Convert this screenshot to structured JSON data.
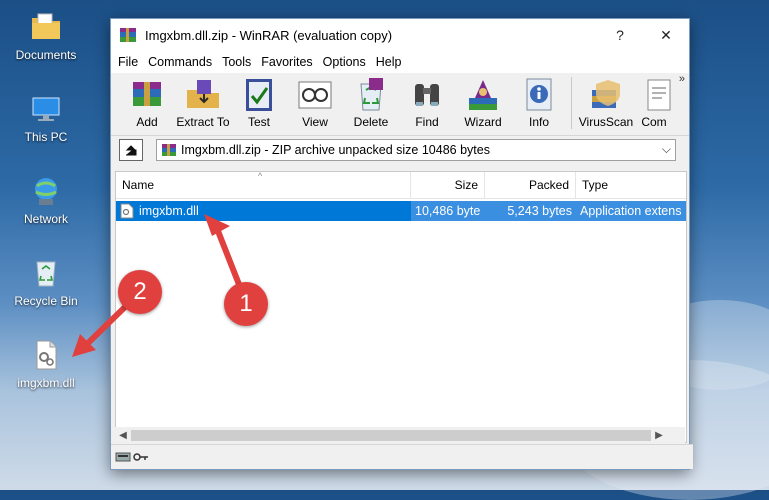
{
  "desktop": {
    "icons": [
      {
        "label": "Documents",
        "icon": "documents-folder-icon"
      },
      {
        "label": "This PC",
        "icon": "this-pc-icon"
      },
      {
        "label": "Network",
        "icon": "network-icon"
      },
      {
        "label": "Recycle Bin",
        "icon": "recycle-bin-icon"
      },
      {
        "label": "imgxbm.dll",
        "icon": "dll-file-icon"
      }
    ]
  },
  "window": {
    "title": "Imgxbm.dll.zip - WinRAR (evaluation copy)",
    "help_button": "?",
    "close_button": "✕"
  },
  "menu": [
    "File",
    "Commands",
    "Tools",
    "Favorites",
    "Options",
    "Help"
  ],
  "toolbar": [
    {
      "label": "Add",
      "icon": "add-archive-icon"
    },
    {
      "label": "Extract To",
      "icon": "extract-to-icon"
    },
    {
      "label": "Test",
      "icon": "test-icon"
    },
    {
      "label": "View",
      "icon": "view-icon"
    },
    {
      "label": "Delete",
      "icon": "delete-icon"
    },
    {
      "label": "Find",
      "icon": "find-binoculars-icon"
    },
    {
      "label": "Wizard",
      "icon": "wizard-icon"
    },
    {
      "label": "Info",
      "icon": "info-icon"
    },
    {
      "label": "VirusScan",
      "icon": "virusscan-icon"
    },
    {
      "label": "Com",
      "icon": "comment-icon"
    }
  ],
  "toolbar_more": "»",
  "address": {
    "up_icon": "up-folder-icon",
    "path": "Imgxbm.dll.zip - ZIP archive unpacked size 10486 bytes",
    "dropdown": "⌵"
  },
  "columns": [
    {
      "key": "name",
      "label": "Name"
    },
    {
      "key": "size",
      "label": "Size"
    },
    {
      "key": "packed",
      "label": "Packed"
    },
    {
      "key": "type",
      "label": "Type"
    }
  ],
  "sort_indicator": "^",
  "files": [
    {
      "name": "imgxbm.dll",
      "size": "10,486 byte",
      "packed": "5,243 bytes",
      "type": "Application extens",
      "selected": true
    }
  ],
  "annotations": {
    "badge1": "1",
    "badge2": "2",
    "color": "#e0403e"
  }
}
